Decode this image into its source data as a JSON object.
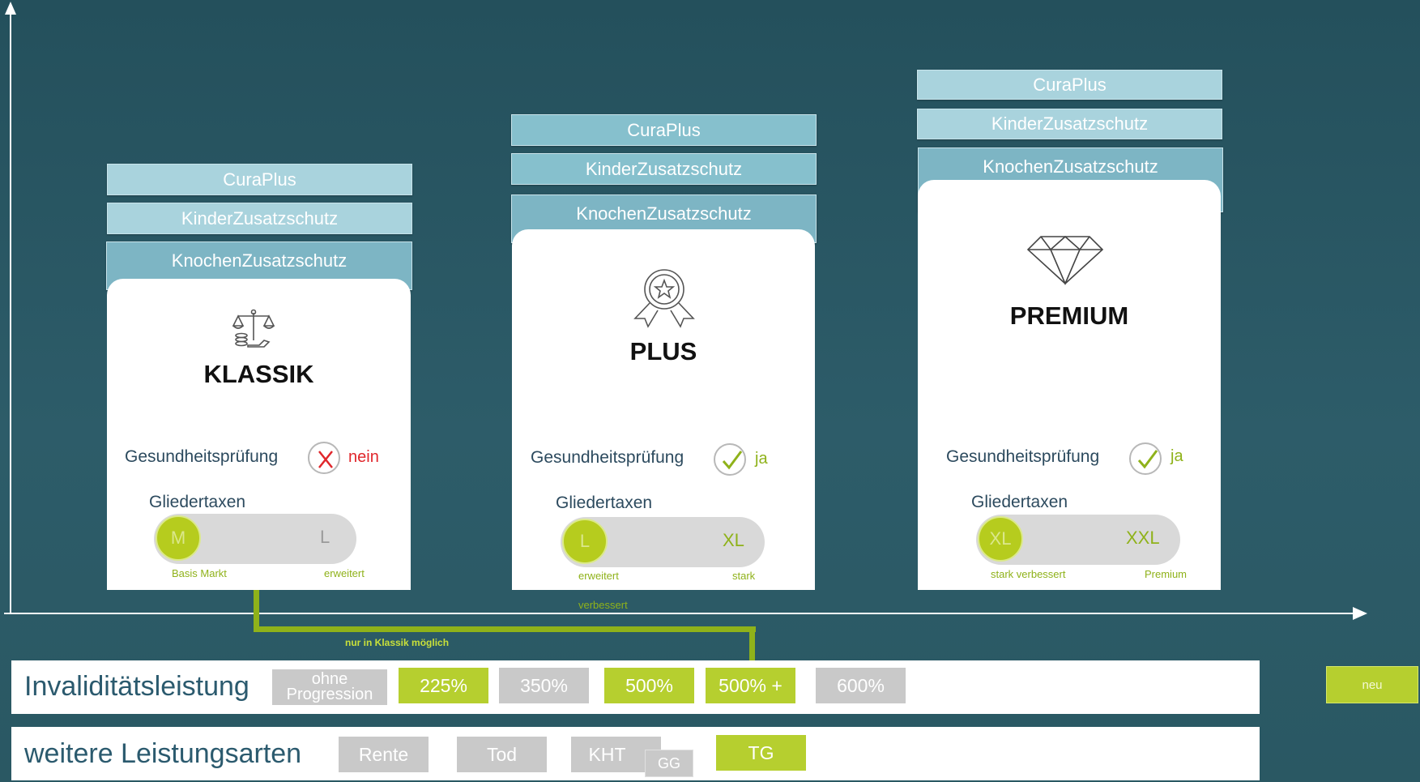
{
  "addons": {
    "curaplus": "CuraPlus",
    "kinder": "KinderZusatzschutz",
    "knochen": "KnochenZusatzschutz"
  },
  "tiers": [
    {
      "title": "KLASSIK",
      "icon": "scale-icon",
      "gp_label": "Gesundheitsprüfung",
      "gp_value": "nein",
      "gt_label": "Gliedertaxen",
      "knob": "M",
      "end": "L",
      "left_label": "Basis Markt",
      "right_label": "erweitert"
    },
    {
      "title": "PLUS",
      "icon": "award-icon",
      "gp_label": "Gesundheitsprüfung",
      "gp_value": "ja",
      "gt_label": "Gliedertaxen",
      "knob": "L",
      "end": "XL",
      "left_label": "erweitert",
      "right_label": "stark",
      "below_label": "verbessert"
    },
    {
      "title": "PREMIUM",
      "icon": "diamond-icon",
      "gp_label": "Gesundheitsprüfung",
      "gp_value": "ja",
      "gt_label": "Gliedertaxen",
      "knob": "XL",
      "end": "XXL",
      "left_label": "stark verbessert",
      "right_label": "Premium"
    }
  ],
  "connector_text": "nur in Klassik möglich",
  "invaliditaet": {
    "title": "Invaliditätsleistung",
    "options": [
      "ohne Progression",
      "225%",
      "350%",
      "500%",
      "500% +",
      "600%"
    ]
  },
  "weitere": {
    "title": "weitere Leistungsarten",
    "options": [
      "Rente",
      "Tod",
      "KHT",
      "GG",
      "TG"
    ]
  },
  "legend_neu": "neu",
  "colors": {
    "background": "#2a5863",
    "accent_green": "#b6cf2f",
    "chip_grey": "#c9c9c9",
    "addon_light": "#a9d3dd",
    "nein_red": "#e0262b"
  }
}
